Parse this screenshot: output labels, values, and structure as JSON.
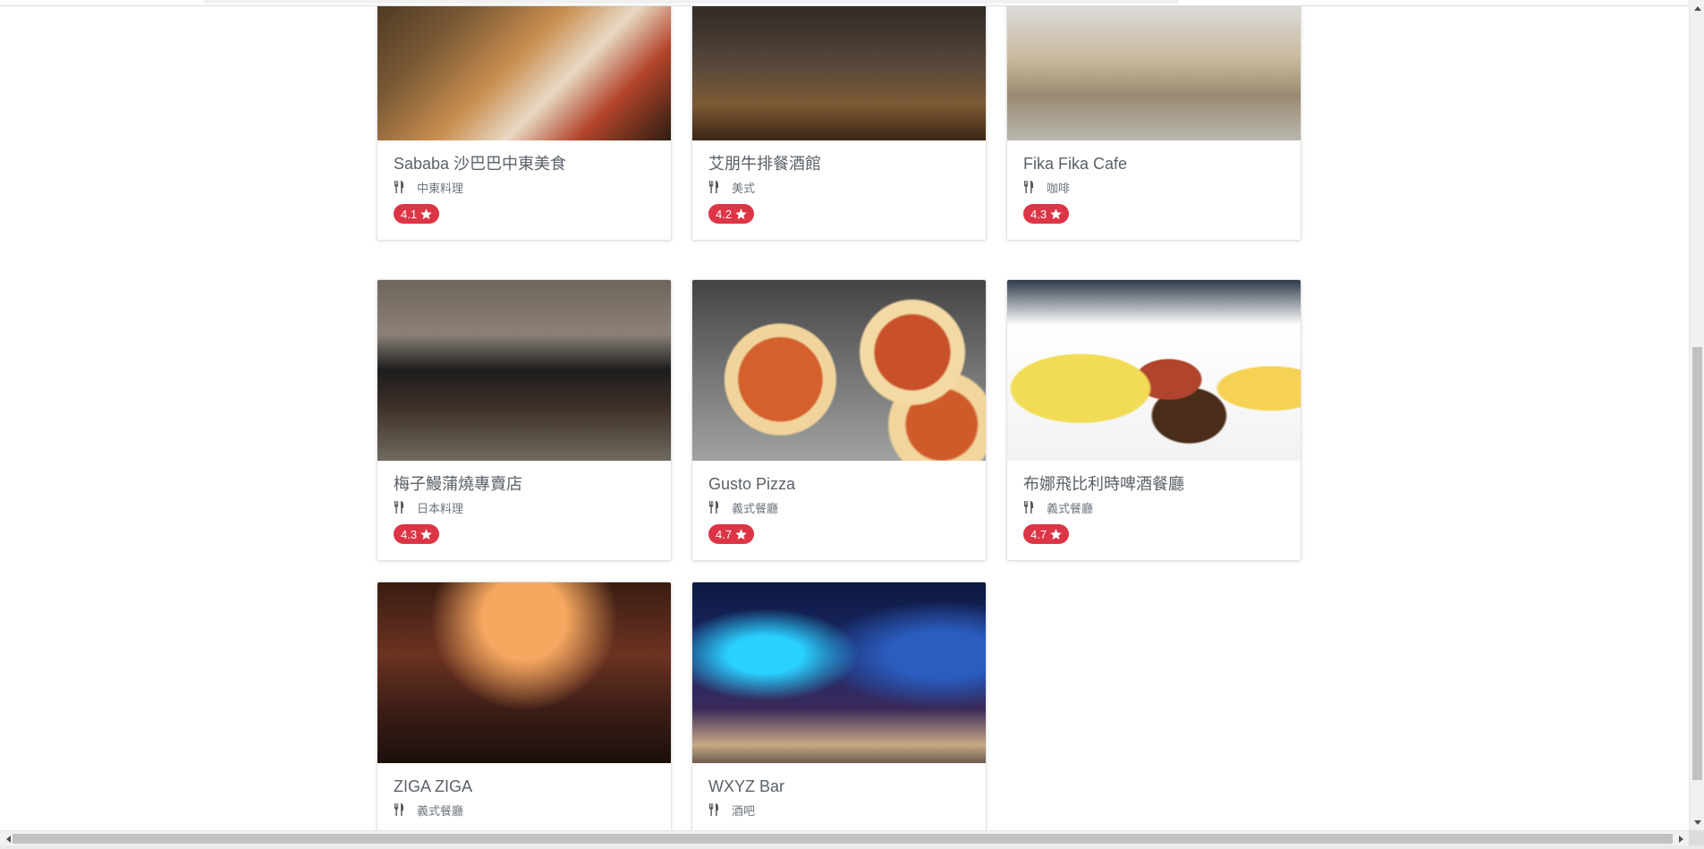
{
  "restaurants": [
    {
      "name": "Sababa 沙巴巴中東美食",
      "category": "中東料理",
      "rating": "4.1",
      "photo": "sababa"
    },
    {
      "name": "艾朋牛排餐酒館",
      "category": "美式",
      "rating": "4.2",
      "photo": "steak"
    },
    {
      "name": "Fika Fika Cafe",
      "category": "咖啡",
      "rating": "4.3",
      "photo": "fika"
    },
    {
      "name": "梅子鰻蒲燒專賣店",
      "category": "日本料理",
      "rating": "4.3",
      "photo": "umeko"
    },
    {
      "name": "Gusto Pizza",
      "category": "義式餐廳",
      "rating": "4.7",
      "photo": "pizza"
    },
    {
      "name": "布娜飛比利時啤酒餐廳",
      "category": "義式餐廳",
      "rating": "4.7",
      "photo": "bruno"
    },
    {
      "name": "ZIGA ZIGA",
      "category": "義式餐廳",
      "rating": "",
      "photo": "ziga"
    },
    {
      "name": "WXYZ Bar",
      "category": "酒吧",
      "rating": "",
      "photo": "wxyz"
    }
  ],
  "icons": {
    "category": "utensils-icon",
    "rating": "star-icon"
  },
  "colors": {
    "rating_badge": "#dc3545",
    "title_text": "#5a6169",
    "category_text": "#6c757d"
  }
}
